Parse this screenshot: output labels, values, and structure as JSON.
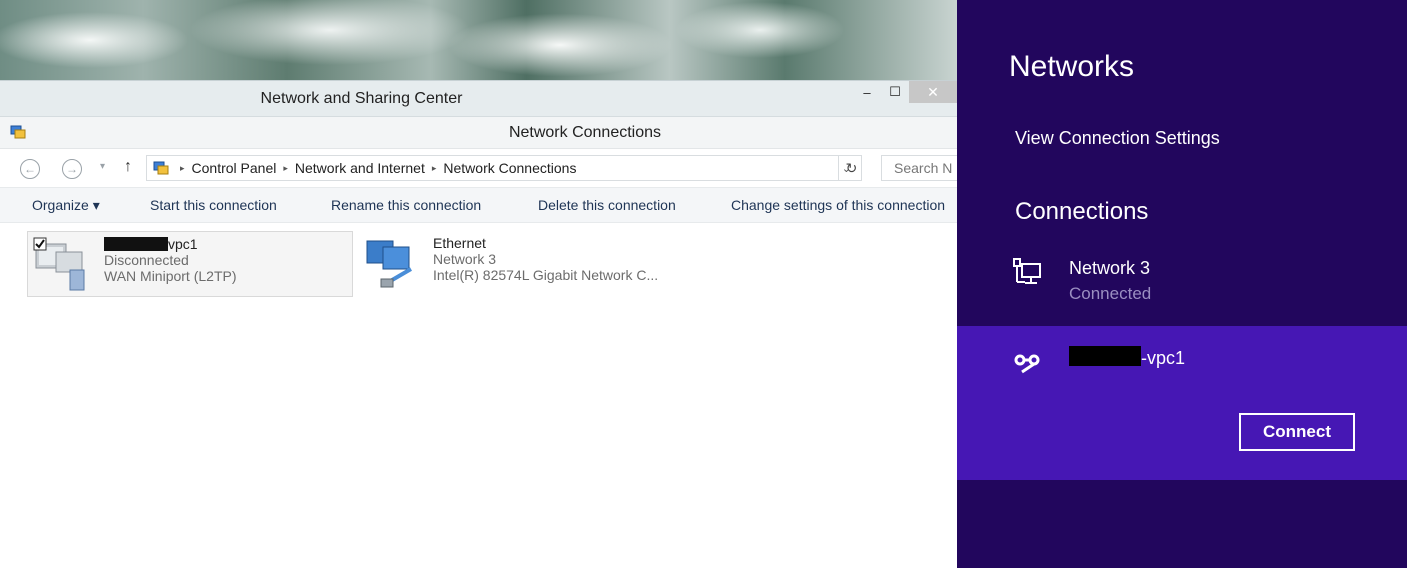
{
  "outer_window": {
    "title": "Network and Sharing Center",
    "controls": {
      "minimize": "–",
      "maximize": "☐",
      "close": "✕"
    }
  },
  "inner_window": {
    "title": "Network Connections"
  },
  "address_bar": {
    "back": "←",
    "forward": "→",
    "dropdown": "▾",
    "up": "↑",
    "path": [
      "Control Panel",
      "Network and Internet",
      "Network Connections"
    ],
    "path_separator": "▸",
    "path_dropdown": "⌄",
    "refresh": "↻",
    "search_placeholder": "Search N"
  },
  "command_bar": {
    "organize": "Organize ▾",
    "start": "Start this connection",
    "rename": "Rename this connection",
    "delete": "Delete this connection",
    "change": "Change settings of this connection"
  },
  "connections": [
    {
      "name_suffix": "vpc1",
      "status": "Disconnected",
      "device": "WAN Miniport (L2TP)",
      "checked": true
    },
    {
      "name": "Ethernet",
      "status": "Network 3",
      "device": "Intel(R) 82574L Gigabit Network C..."
    }
  ],
  "networks_panel": {
    "title": "Networks",
    "settings_link": "View Connection Settings",
    "connections_heading": "Connections",
    "items": [
      {
        "name": "Network 3",
        "status": "Connected",
        "icon": "ethernet-icon"
      },
      {
        "name_suffix": "-vpc1",
        "icon": "vpn-icon",
        "button": "Connect"
      }
    ]
  },
  "colors": {
    "charm_bg": "#22065d",
    "charm_selected": "#4617b4",
    "link_text": "#1e3455"
  }
}
